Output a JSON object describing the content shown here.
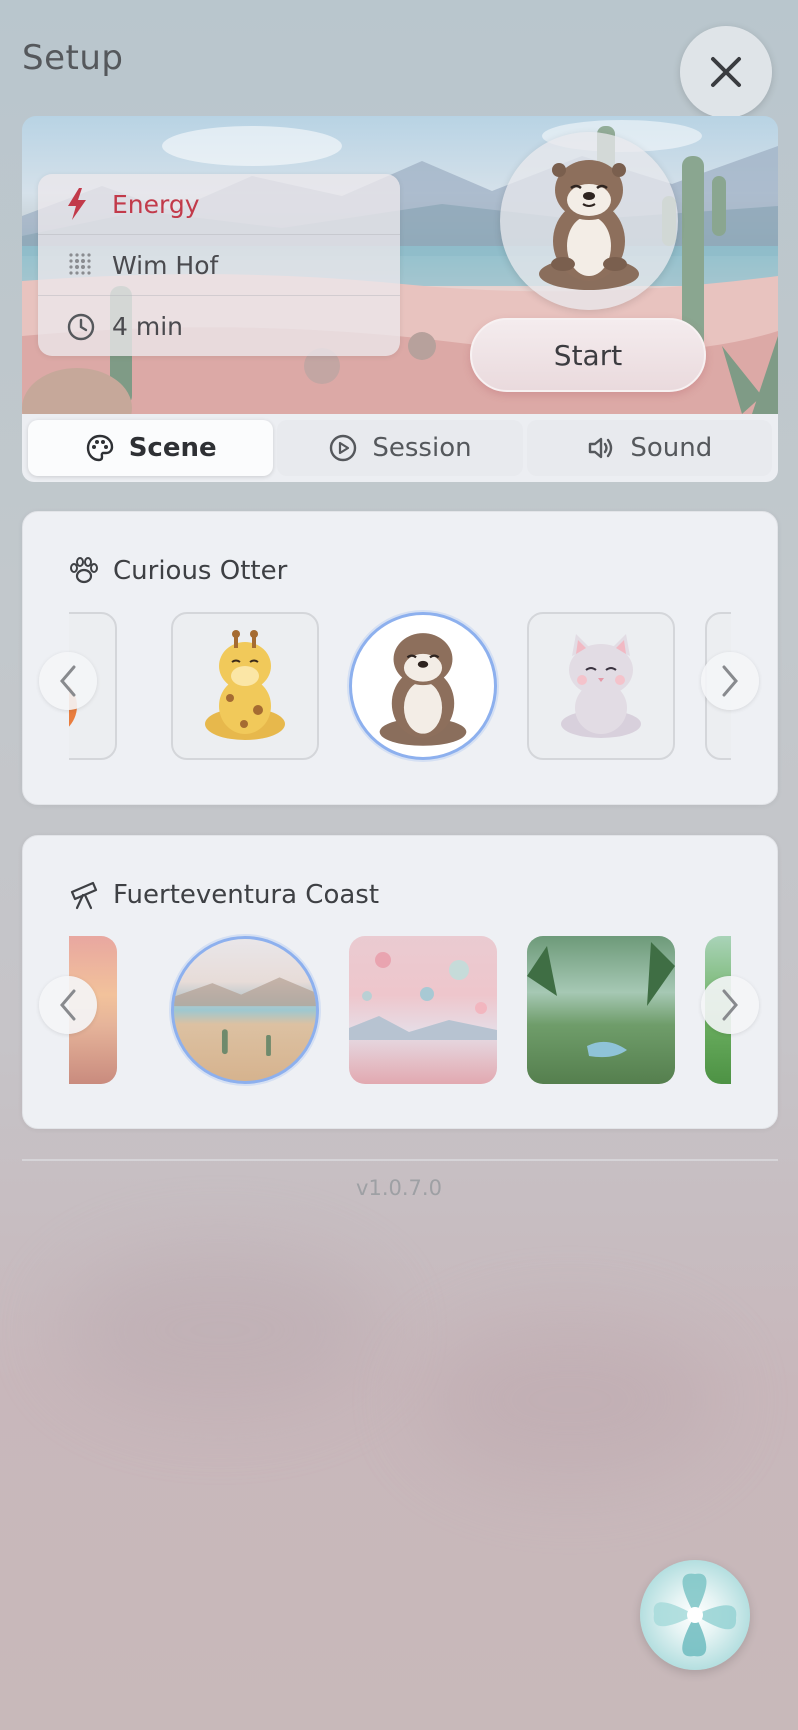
{
  "header": {
    "title": "Setup",
    "close_icon": "close-icon"
  },
  "hero": {
    "info": [
      {
        "icon": "lightning-icon",
        "label": "Energy",
        "color": "#c23a4a"
      },
      {
        "icon": "dots-grid-icon",
        "label": "Wim Hof",
        "color": "#4a4a4e"
      },
      {
        "icon": "timer-icon",
        "label": "4 min",
        "color": "#4a4a4e"
      }
    ],
    "avatar": "otter-avatar",
    "start_label": "Start"
  },
  "tabs": [
    {
      "icon": "palette-icon",
      "label": "Scene",
      "active": true
    },
    {
      "icon": "play-circle-icon",
      "label": "Session",
      "active": false
    },
    {
      "icon": "speaker-icon",
      "label": "Sound",
      "active": false
    }
  ],
  "character_panel": {
    "icon": "paw-icon",
    "title": "Curious Otter",
    "items": [
      "fox",
      "giraffe",
      "otter",
      "cat",
      "frog"
    ],
    "selected": "otter"
  },
  "scene_panel": {
    "icon": "telescope-icon",
    "title": "Fuerteventura Coast",
    "items": [
      "sunset-desert",
      "fuerteventura-coast",
      "pastel-planets",
      "green-valley",
      "rice-terraces"
    ],
    "selected": "fuerteventura-coast"
  },
  "footer": {
    "version": "v1.0.7.0"
  },
  "colors": {
    "accent": "#8db0ee",
    "energy": "#c23a4a",
    "fab": "#8ec9cc"
  }
}
